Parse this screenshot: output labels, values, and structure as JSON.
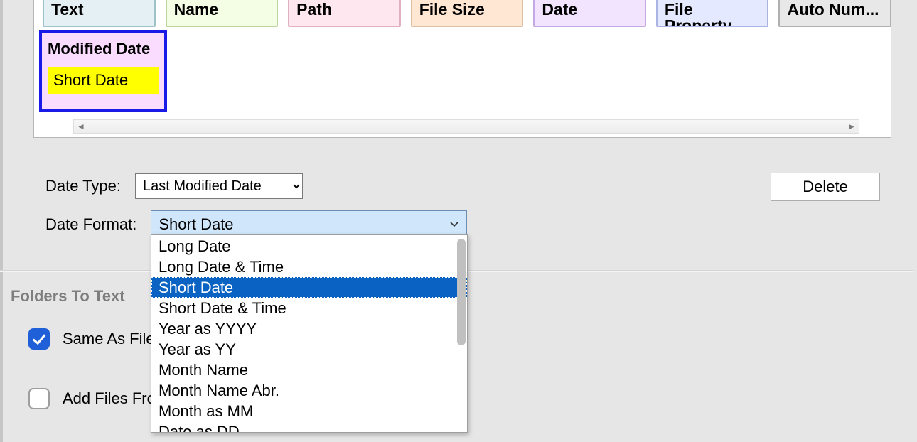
{
  "tabs": {
    "text": "Text",
    "name": "Name",
    "path": "Path",
    "size": "File Size",
    "date": "Date",
    "prop": "File Property",
    "num": "Auto Num..."
  },
  "selected_component": {
    "title": "Modified Date",
    "value": "Short Date"
  },
  "form": {
    "date_type_label": "Date Type:",
    "date_type_value": "Last Modified Date",
    "date_format_label": "Date Format:",
    "date_format_value": "Short Date"
  },
  "dropdown": {
    "options": [
      "Long Date",
      "Long Date & Time",
      "Short Date",
      "Short Date & Time",
      "Year as YYYY",
      "Year as YY",
      "Month Name",
      "Month Name Abr.",
      "Month as MM",
      "Date as DD"
    ],
    "selected": "Short Date"
  },
  "buttons": {
    "delete": "Delete"
  },
  "folders_section": {
    "title": "Folders To Text",
    "same_as_files_label": "Same As Files",
    "same_as_files_checked": true,
    "add_files_label": "Add Files From",
    "add_files_checked": false
  }
}
